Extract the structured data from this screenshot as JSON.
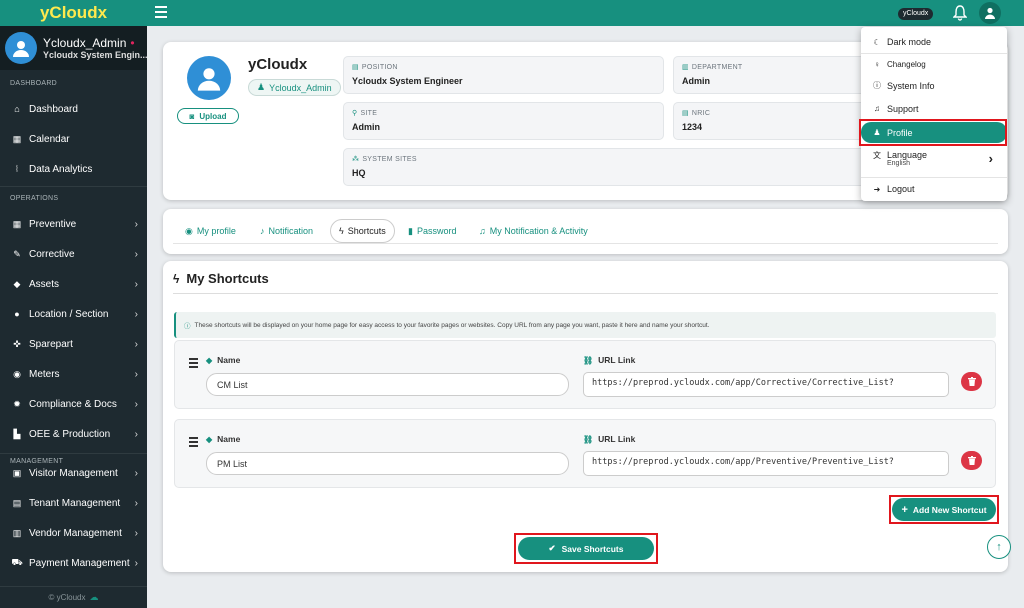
{
  "brand": {
    "name": "yCloudx"
  },
  "user": {
    "name": "Ycloudx_Admin",
    "role": "Ycloudx System Engin...",
    "online_dot": "•"
  },
  "sidebar": {
    "sections": {
      "dashboard": "DASHBOARD",
      "operations": "OPERATIONS",
      "management": "MANAGEMENT"
    },
    "items": [
      {
        "label": "Dashboard",
        "icon": "home-icon",
        "glyph": "⌂"
      },
      {
        "label": "Calendar",
        "icon": "calendar-icon",
        "glyph": "▦"
      },
      {
        "label": "Data Analytics",
        "icon": "chart-line-icon",
        "glyph": "⦚"
      },
      {
        "label": "Preventive",
        "icon": "calendar-check-icon",
        "glyph": "▦"
      },
      {
        "label": "Corrective",
        "icon": "wrench-icon",
        "glyph": "✎"
      },
      {
        "label": "Assets",
        "icon": "tag-icon",
        "glyph": "◆"
      },
      {
        "label": "Location / Section",
        "icon": "location-icon",
        "glyph": "●"
      },
      {
        "label": "Sparepart",
        "icon": "parts-icon",
        "glyph": "✜"
      },
      {
        "label": "Meters",
        "icon": "gauge-icon",
        "glyph": "◉"
      },
      {
        "label": "Compliance & Docs",
        "icon": "badge-icon",
        "glyph": "✹"
      },
      {
        "label": "OEE & Production",
        "icon": "factory-icon",
        "glyph": "▙"
      },
      {
        "label": "Visitor Management",
        "icon": "id-card-icon",
        "glyph": "▣"
      },
      {
        "label": "Tenant Management",
        "icon": "building-icon",
        "glyph": "▤"
      },
      {
        "label": "Vendor Management",
        "icon": "vcard-icon",
        "glyph": "▥"
      },
      {
        "label": "Payment Management",
        "icon": "cart-icon",
        "glyph": "⛟"
      }
    ],
    "chevron": "›",
    "footer": "© yCloudx"
  },
  "topbar": {
    "badge": "yCloudx"
  },
  "profile": {
    "name": "yCloudx",
    "chip": "Ycloudx_Admin",
    "upload_label": "Upload",
    "fields": {
      "position": {
        "label": "POSITION",
        "value": "Ycloudx System Engineer"
      },
      "department": {
        "label": "DEPARTMENT",
        "value": "Admin"
      },
      "site": {
        "label": "SITE",
        "value": "Admin"
      },
      "nric": {
        "label": "NRIC",
        "value": "1234"
      },
      "system_sites": {
        "label": "SYSTEM SITES",
        "value": "HQ"
      }
    }
  },
  "tabs": [
    {
      "label": "My profile",
      "icon": "user-circle-icon",
      "glyph": "◉"
    },
    {
      "label": "Notification",
      "icon": "bell-icon",
      "glyph": "♪"
    },
    {
      "label": "Shortcuts",
      "icon": "bolt-icon",
      "glyph": "ϟ",
      "active": true
    },
    {
      "label": "Password",
      "icon": "lock-icon",
      "glyph": "▮"
    },
    {
      "label": "My Notification & Activity",
      "icon": "bell-outline-icon",
      "glyph": "♫"
    }
  ],
  "shortcuts": {
    "title": "My Shortcuts",
    "note": "These shortcuts will be displayed on your home page for easy access to your favorite pages or websites. Copy URL from any page you want, paste it here and name your shortcut.",
    "name_label": "Name",
    "url_label": "URL Link",
    "rows": [
      {
        "name": "CM List",
        "url": "https://preprod.ycloudx.com/app/Corrective/Corrective_List?"
      },
      {
        "name": "PM List",
        "url": "https://preprod.ycloudx.com/app/Preventive/Preventive_List?"
      }
    ],
    "add_label": "Add New Shortcut",
    "save_label": "Save Shortcuts"
  },
  "dropdown": {
    "items": [
      {
        "label": "Dark mode",
        "icon": "moon-icon",
        "glyph": "☾"
      },
      {
        "label": "Changelog",
        "icon": "bulb-icon",
        "glyph": "♀"
      },
      {
        "label": "System Info",
        "icon": "info-icon",
        "glyph": "ⓘ"
      },
      {
        "label": "Support",
        "icon": "headset-icon",
        "glyph": "♫"
      },
      {
        "label": "Profile",
        "icon": "user-icon",
        "glyph": "♟",
        "active": true
      },
      {
        "label": "Language",
        "icon": "language-icon",
        "glyph": "文",
        "sub": "English"
      },
      {
        "label": "Logout",
        "icon": "logout-icon",
        "glyph": "➜"
      }
    ]
  },
  "colors": {
    "accent": "#17907f",
    "sidebar": "#1e2a30",
    "brand_text": "#ffe94d",
    "danger": "#dc3545",
    "highlight": "#e0161d"
  }
}
